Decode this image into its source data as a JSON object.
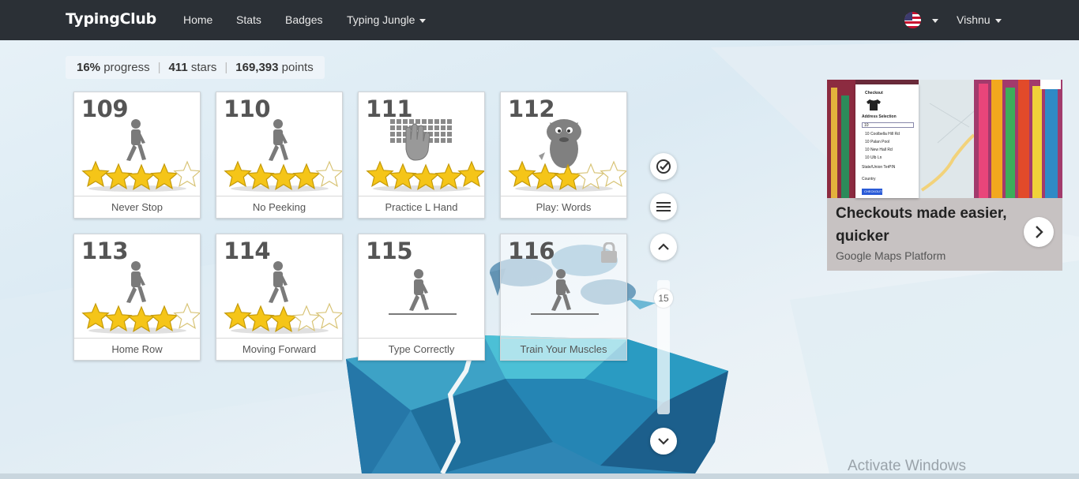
{
  "nav": {
    "brand": "TypingClub",
    "links": [
      "Home",
      "Stats",
      "Badges",
      "Typing Jungle"
    ],
    "user": "Vishnu",
    "flag_icon": "us-flag-icon"
  },
  "progress": {
    "percent": "16%",
    "percent_label": "progress",
    "stars": "411",
    "stars_label": "stars",
    "points": "169,393",
    "points_label": "points"
  },
  "lessons": [
    {
      "num": "109",
      "name": "Never Stop",
      "stars": 4,
      "art": "walker"
    },
    {
      "num": "110",
      "name": "No Peeking",
      "stars": 4,
      "art": "walker"
    },
    {
      "num": "111",
      "name": "Practice L Hand",
      "stars": 5,
      "art": "keyboard-hand"
    },
    {
      "num": "112",
      "name": "Play: Words",
      "stars": 3,
      "art": "monster"
    },
    {
      "num": "113",
      "name": "Home Row",
      "stars": 4,
      "art": "walker"
    },
    {
      "num": "114",
      "name": "Moving Forward",
      "stars": 3,
      "art": "walker"
    },
    {
      "num": "115",
      "name": "Type Correctly",
      "stars": 0,
      "art": "walker-line"
    },
    {
      "num": "116",
      "name": "Train Your Muscles",
      "stars": 0,
      "art": "walker-line",
      "locked": true
    }
  ],
  "side": {
    "level": "15"
  },
  "ad": {
    "title": "Checkouts made easier, quicker",
    "source": "Google Maps Platform",
    "checkout_title": "Checkout",
    "address_label": "Address Selection",
    "search_value": "10",
    "addresses": [
      "10 Coolbella Hill Rd",
      "10 Palan Pool",
      "10 New Hall Rd",
      "10 Ulb Ln"
    ],
    "fields": [
      "State/Union Ter",
      "PIN",
      "Country"
    ],
    "checkout_button": "CHECKOUT"
  },
  "watermark": "Activate Windows",
  "colors": {
    "nav_bg": "#2b3036",
    "star": "#f5c518",
    "card_text": "#555555"
  }
}
